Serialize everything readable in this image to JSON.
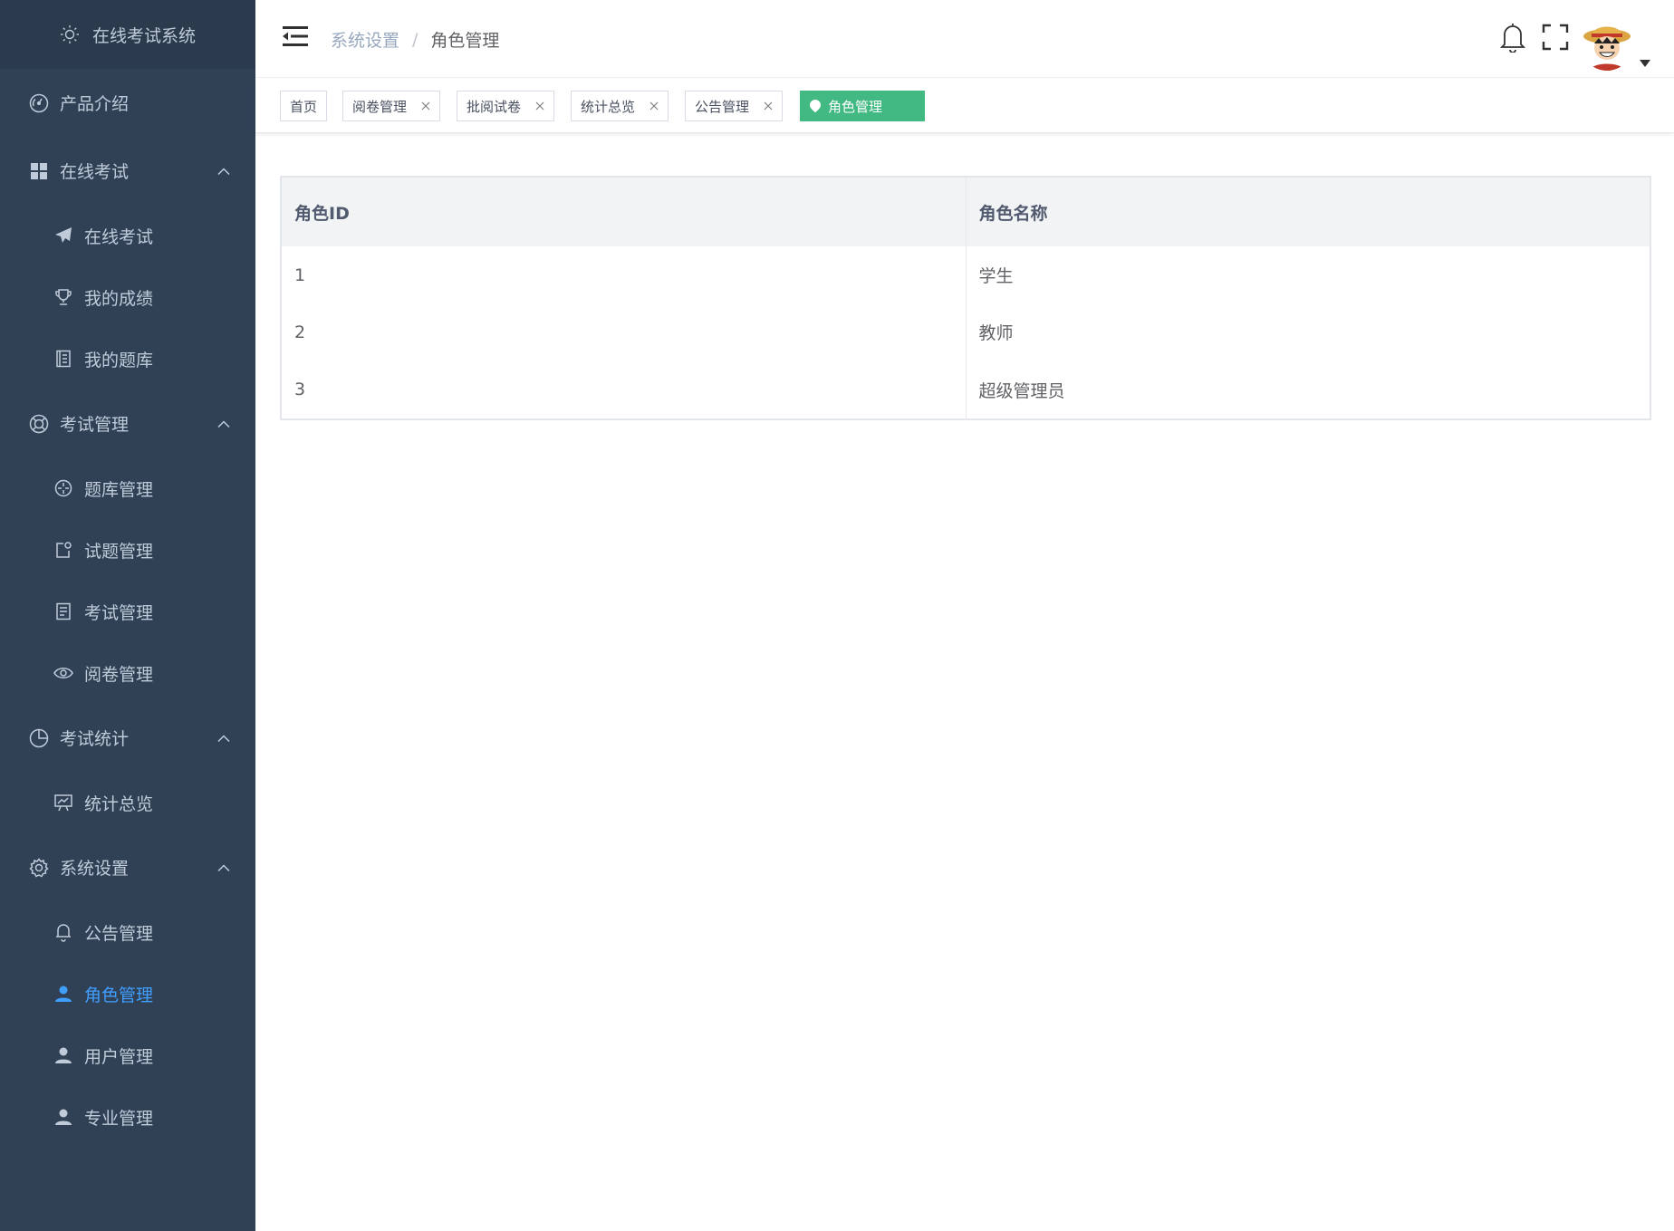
{
  "app": {
    "title": "在线考试系统"
  },
  "sidebar": {
    "items": [
      {
        "type": "top",
        "label": "产品介绍",
        "icon": "dashboard-icon"
      },
      {
        "type": "top",
        "label": "在线考试",
        "icon": "grid-icon",
        "expanded": true
      },
      {
        "type": "sub",
        "label": "在线考试",
        "icon": "paper-plane-icon"
      },
      {
        "type": "sub",
        "label": "我的成绩",
        "icon": "trophy-icon"
      },
      {
        "type": "sub",
        "label": "我的题库",
        "icon": "notebook-icon"
      },
      {
        "type": "top",
        "label": "考试管理",
        "icon": "lifebuoy-icon",
        "expanded": true
      },
      {
        "type": "sub",
        "label": "题库管理",
        "icon": "compass-icon"
      },
      {
        "type": "sub",
        "label": "试题管理",
        "icon": "doc-edit-icon"
      },
      {
        "type": "sub",
        "label": "考试管理",
        "icon": "document-icon"
      },
      {
        "type": "sub",
        "label": "阅卷管理",
        "icon": "eye-icon"
      },
      {
        "type": "top",
        "label": "考试统计",
        "icon": "pie-chart-icon",
        "expanded": true
      },
      {
        "type": "sub",
        "label": "统计总览",
        "icon": "presentation-chart-icon"
      },
      {
        "type": "top",
        "label": "系统设置",
        "icon": "gear-icon",
        "expanded": true
      },
      {
        "type": "sub",
        "label": "公告管理",
        "icon": "bell-icon"
      },
      {
        "type": "sub",
        "label": "角色管理",
        "icon": "user-icon",
        "active": true
      },
      {
        "type": "sub",
        "label": "用户管理",
        "icon": "user-icon"
      },
      {
        "type": "sub",
        "label": "专业管理",
        "icon": "user-icon"
      }
    ]
  },
  "breadcrumb": {
    "items": [
      "系统设置",
      "角色管理"
    ],
    "separator": "/"
  },
  "tags": [
    {
      "label": "首页",
      "closable": false,
      "active": false
    },
    {
      "label": "阅卷管理",
      "closable": true,
      "active": false
    },
    {
      "label": "批阅试卷",
      "closable": true,
      "active": false
    },
    {
      "label": "统计总览",
      "closable": true,
      "active": false
    },
    {
      "label": "公告管理",
      "closable": true,
      "active": false
    },
    {
      "label": "角色管理",
      "closable": false,
      "active": true
    }
  ],
  "table": {
    "columns": [
      "角色ID",
      "角色名称"
    ],
    "rows": [
      [
        "1",
        "学生"
      ],
      [
        "2",
        "教师"
      ],
      [
        "3",
        "超级管理员"
      ]
    ]
  },
  "colors": {
    "sidebar_bg": "#304156",
    "sidebar_logo_bg": "#2b3a4c",
    "sidebar_text": "#bfcbd9",
    "active_blue": "#409eff",
    "tag_active_green": "#42b983"
  }
}
